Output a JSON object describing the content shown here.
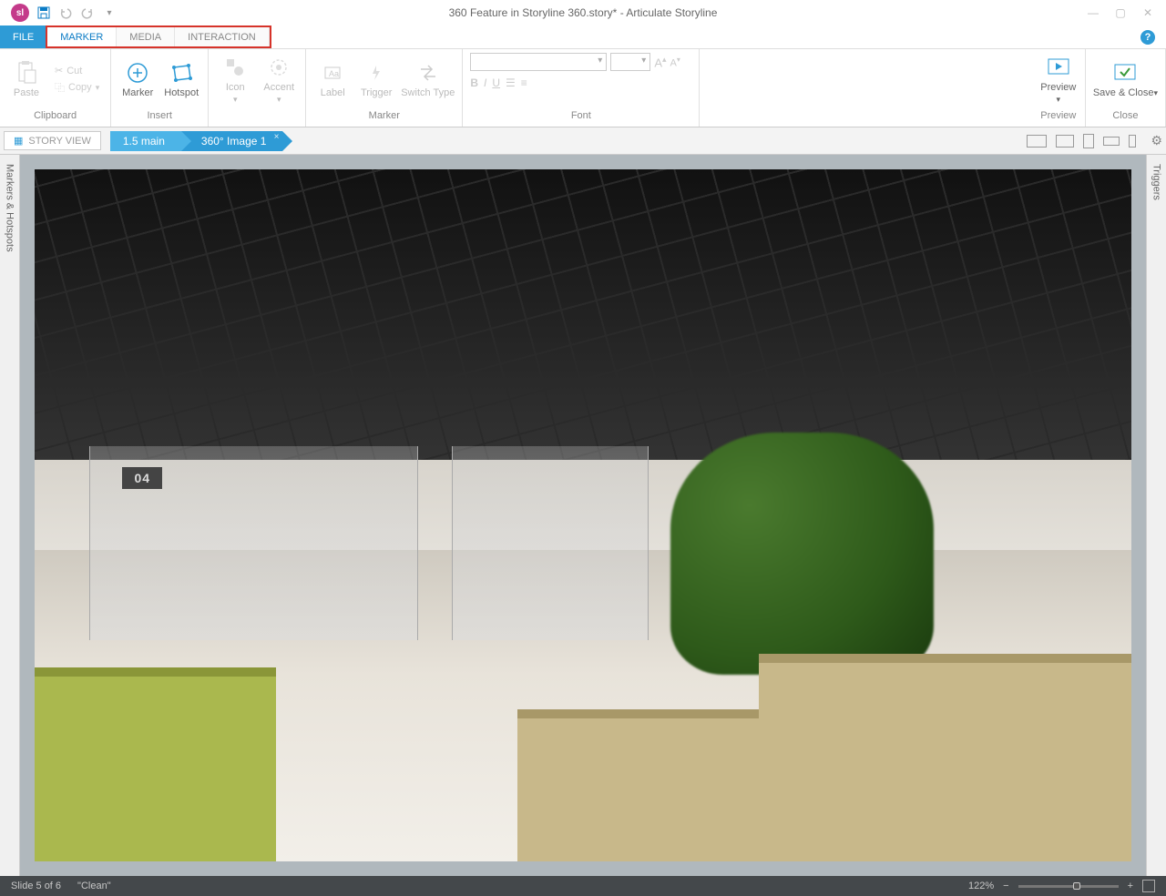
{
  "title": "360 Feature in Storyline 360.story*  -  Articulate Storyline",
  "app_badge": "sl",
  "qat": {
    "save": "save",
    "undo": "undo",
    "redo": "redo",
    "customize": "▾"
  },
  "tabs": {
    "file": "FILE",
    "marker": "MARKER",
    "media": "MEDIA",
    "interaction": "INTERACTION"
  },
  "ribbon": {
    "clipboard": {
      "label": "Clipboard",
      "paste": "Paste",
      "cut": "Cut",
      "copy": "Copy"
    },
    "insert": {
      "label": "Insert",
      "marker": "Marker",
      "hotspot": "Hotspot"
    },
    "unnamed1": {
      "icon": "Icon",
      "accent": "Accent"
    },
    "marker_group": {
      "label": "Marker",
      "label_btn": "Label",
      "trigger": "Trigger",
      "switch": "Switch Type"
    },
    "font": {
      "label": "Font",
      "grow": "A",
      "shrink": "A",
      "bold": "B",
      "italic": "I",
      "underline": "U"
    },
    "preview": {
      "label": "Preview",
      "btn": "Preview"
    },
    "close": {
      "label": "Close",
      "btn": "Save & Close"
    }
  },
  "breadcrumb": {
    "story_view": "STORY VIEW",
    "item1": "1.5 main",
    "item2": "360° Image 1"
  },
  "side_panels": {
    "left": "Markers & Hotspots",
    "right": "Triggers"
  },
  "scene": {
    "sign": "04"
  },
  "status": {
    "slide": "Slide 5 of 6",
    "layout": "\"Clean\"",
    "zoom": "122%"
  }
}
